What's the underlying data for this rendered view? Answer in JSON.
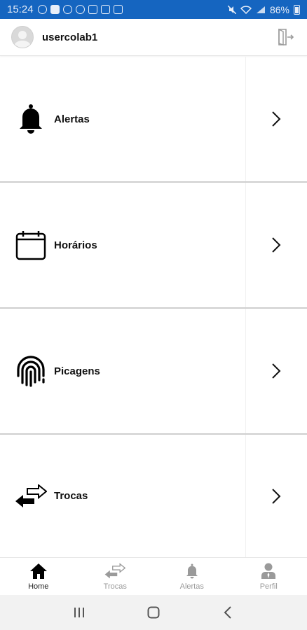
{
  "status_bar": {
    "time": "15:24",
    "battery": "86%"
  },
  "header": {
    "username": "usercolab1"
  },
  "menu": {
    "items": [
      {
        "label": "Alertas",
        "icon": "bell-icon"
      },
      {
        "label": "Horários",
        "icon": "calendar-icon"
      },
      {
        "label": "Picagens",
        "icon": "fingerprint-icon"
      },
      {
        "label": "Trocas",
        "icon": "swap-arrows-icon"
      }
    ]
  },
  "bottom_nav": {
    "items": [
      {
        "label": "Home",
        "icon": "home-icon",
        "active": true
      },
      {
        "label": "Trocas",
        "icon": "swap-arrows-icon",
        "active": false
      },
      {
        "label": "Alertas",
        "icon": "bell-icon",
        "active": false
      },
      {
        "label": "Perfil",
        "icon": "user-icon",
        "active": false
      }
    ]
  },
  "colors": {
    "status_bar": "#1565c0",
    "active_tab": "#222222",
    "inactive_tab": "#9a9a9a"
  }
}
